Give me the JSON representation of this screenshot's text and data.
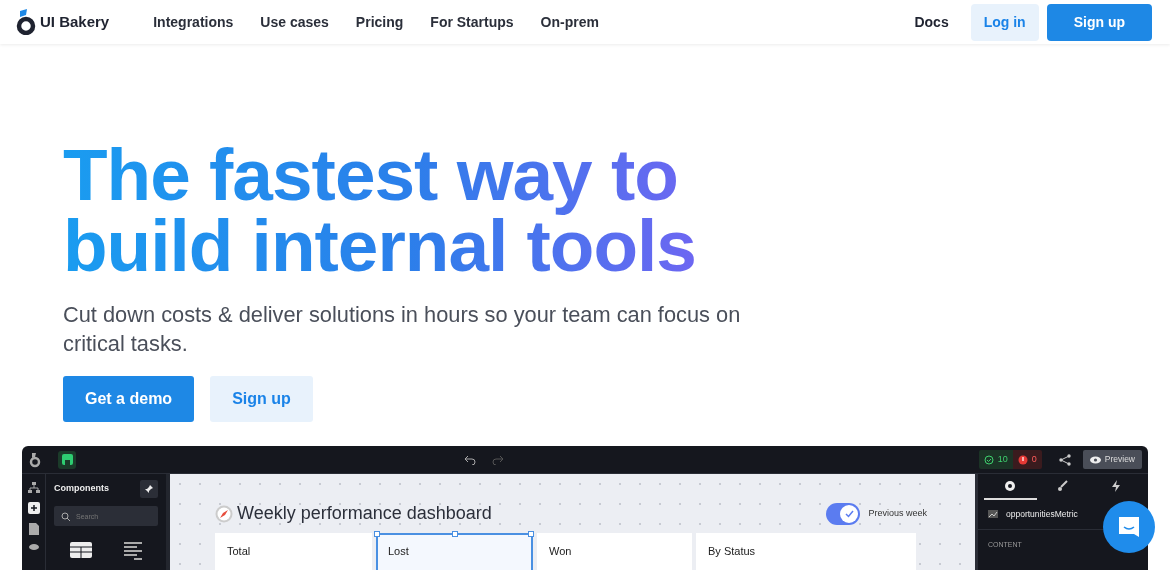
{
  "nav": {
    "brand": "UI Bakery",
    "links": [
      "Integrations",
      "Use cases",
      "Pricing",
      "For Startups",
      "On-prem"
    ],
    "actions": [
      {
        "label": "Docs",
        "kind": "link"
      },
      {
        "label": "Log in",
        "kind": "light"
      },
      {
        "label": "Sign up",
        "kind": "primary"
      }
    ]
  },
  "hero": {
    "title": "The fastest way to build internal tools",
    "subtitle": "Cut down costs & deliver solutions in hours so your team can focus on critical tasks.",
    "buttons": [
      {
        "label": "Get a demo",
        "kind": "primary"
      },
      {
        "label": "Sign up",
        "kind": "light"
      }
    ]
  },
  "app_preview": {
    "toolbar": {
      "passed": "10",
      "errors": "0",
      "preview": "Preview"
    },
    "sidebar": {
      "title": "Components",
      "search": {
        "placeholder": "Search"
      }
    },
    "canvas": {
      "title": "Weekly performance dashboard",
      "toggle": {
        "label": "Previous week",
        "on": true
      },
      "cards": [
        {
          "title": "Total",
          "selected": false
        },
        {
          "title": "Lost",
          "selected": true
        },
        {
          "title": "Won",
          "selected": false
        },
        {
          "title": "By Status",
          "selected": false
        }
      ]
    },
    "inspector": {
      "tabs": [
        {
          "kind": "settings",
          "selected": true
        },
        {
          "kind": "style",
          "selected": false
        },
        {
          "kind": "actions",
          "selected": false
        }
      ],
      "component": "opportunitiesMetric",
      "section": "CONTENT"
    }
  }
}
